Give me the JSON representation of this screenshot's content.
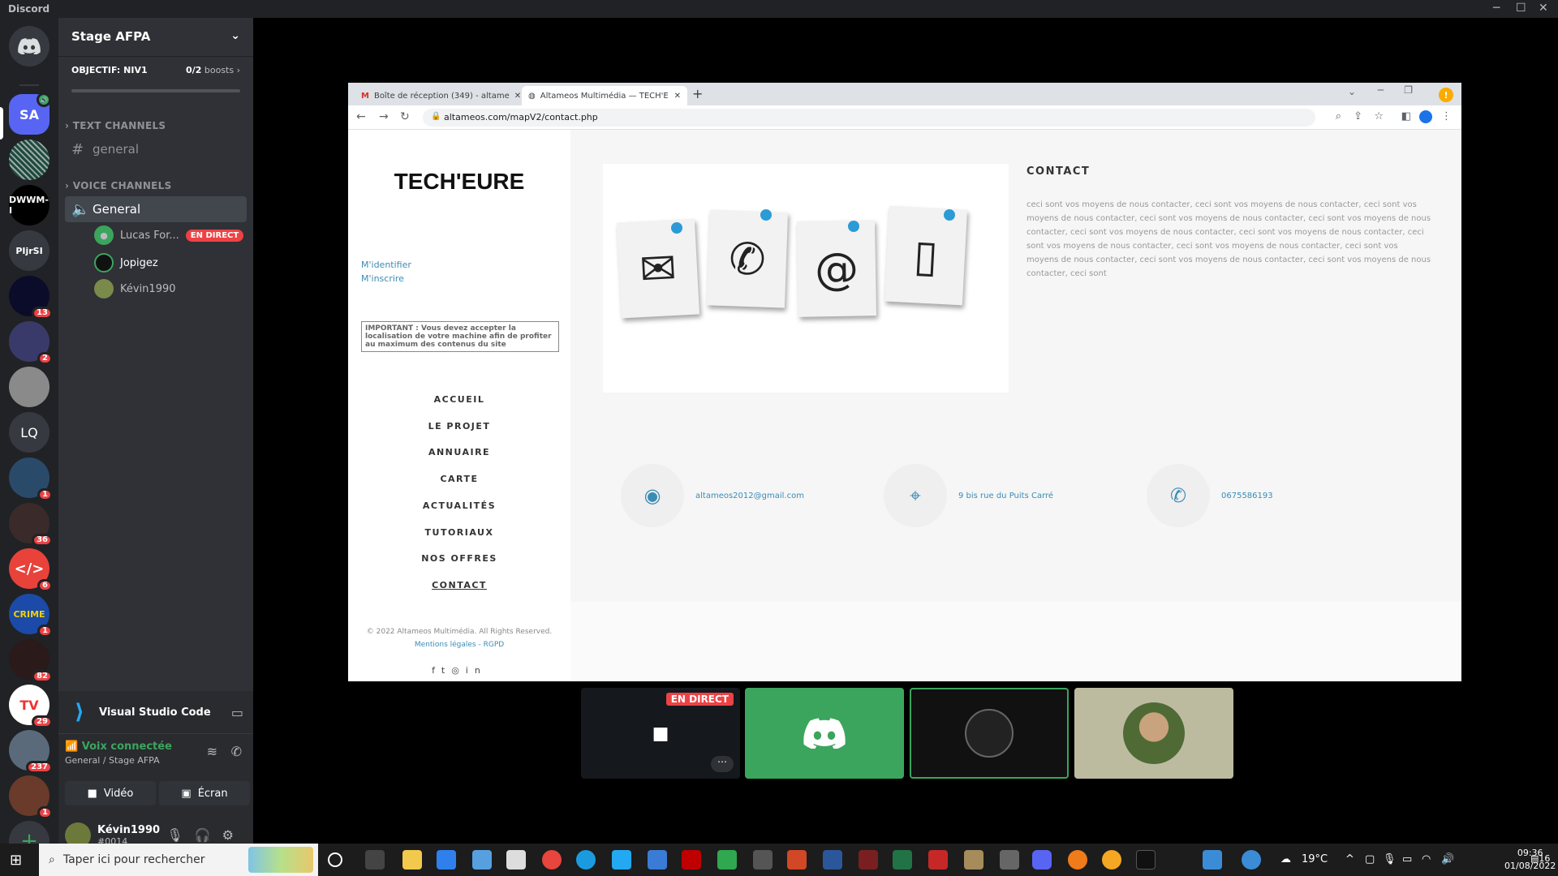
{
  "titlebar": {
    "app": "Discord",
    "min": "─",
    "max": "☐",
    "close": "✕"
  },
  "guilds": [
    {
      "label": "SA",
      "color": "#5865f2",
      "badge": "",
      "top": 0
    },
    {
      "label": "DWWM-I",
      "color": "#2f3136",
      "badge": "",
      "top": 0
    },
    {
      "label": "PIjrSI",
      "color": "#36393f",
      "badge": "",
      "top": 0
    },
    {
      "label": "LQ",
      "color": "#36393f",
      "badge": "",
      "top": 0
    }
  ],
  "guild_badges": [
    "13",
    "2",
    "1",
    "36",
    "6",
    "1",
    "82",
    "29",
    "237",
    "1"
  ],
  "server": {
    "name": "Stage AFPA",
    "boost_goal": "OBJECTIF: NIV1",
    "boost_count": "0/2",
    "boost_unit": "boosts",
    "text_category": "TEXT CHANNELS",
    "text_channel": "general",
    "voice_category": "VOICE CHANNELS",
    "voice_channel": "General",
    "voice_users": [
      {
        "name": "Lucas For...",
        "live": "EN DIRECT"
      },
      {
        "name": "Jopigez",
        "live": ""
      },
      {
        "name": "Kévin1990",
        "live": ""
      }
    ]
  },
  "activity": {
    "app": "Visual Studio Code"
  },
  "voice": {
    "status": "Voix connectée",
    "where": "General / Stage AFPA",
    "video_label": "Vidéo",
    "screen_label": "Écran"
  },
  "user": {
    "name": "Kévin1990",
    "tag": "#0014"
  },
  "browser": {
    "tabs": [
      {
        "label": "Boîte de réception (349) - altame"
      },
      {
        "label": "Altameos Multimédia — TECH'E"
      }
    ],
    "url": "altameos.com/mapV2/contact.php"
  },
  "site": {
    "logo": "TECH'EURE",
    "login": "M'identifier",
    "register": "M'inscrire",
    "important": "IMPORTANT : Vous devez accepter la localisation de votre machine afin de profiter au maximum des contenus du site",
    "menu": [
      "ACCUEIL",
      "LE PROJET",
      "ANNUAIRE",
      "CARTE",
      "ACTUALITÉS",
      "TUTORIAUX",
      "NOS OFFRES",
      "CONTACT"
    ],
    "footer": "© 2022 Altameos Multimédia. All Rights Reserved.",
    "footer_links": "Mentions légales - RGPD",
    "contact_title": "CONTACT",
    "contact_text": "ceci sont vos moyens de nous contacter, ceci sont vos moyens de nous contacter, ceci sont vos moyens de nous contacter, ceci sont vos moyens de nous contacter, ceci sont vos moyens de nous contacter, ceci sont vos moyens de nous contacter, ceci sont vos moyens de nous contacter, ceci sont vos moyens de nous contacter, ceci sont vos moyens de nous contacter, ceci sont vos moyens de nous contacter, ceci sont vos moyens de nous contacter, ceci sont vos moyens de nous contacter, ceci sont",
    "email": "altameos2012@gmail.com",
    "address": "9 bis rue du Puits Carré",
    "phone": "0675586193"
  },
  "stream": {
    "live": "EN DIRECT"
  },
  "taskbar": {
    "search": "Taper ici pour rechercher",
    "temp": "19°C",
    "time": "09:36",
    "date": "01/08/2022",
    "notif": "16"
  }
}
